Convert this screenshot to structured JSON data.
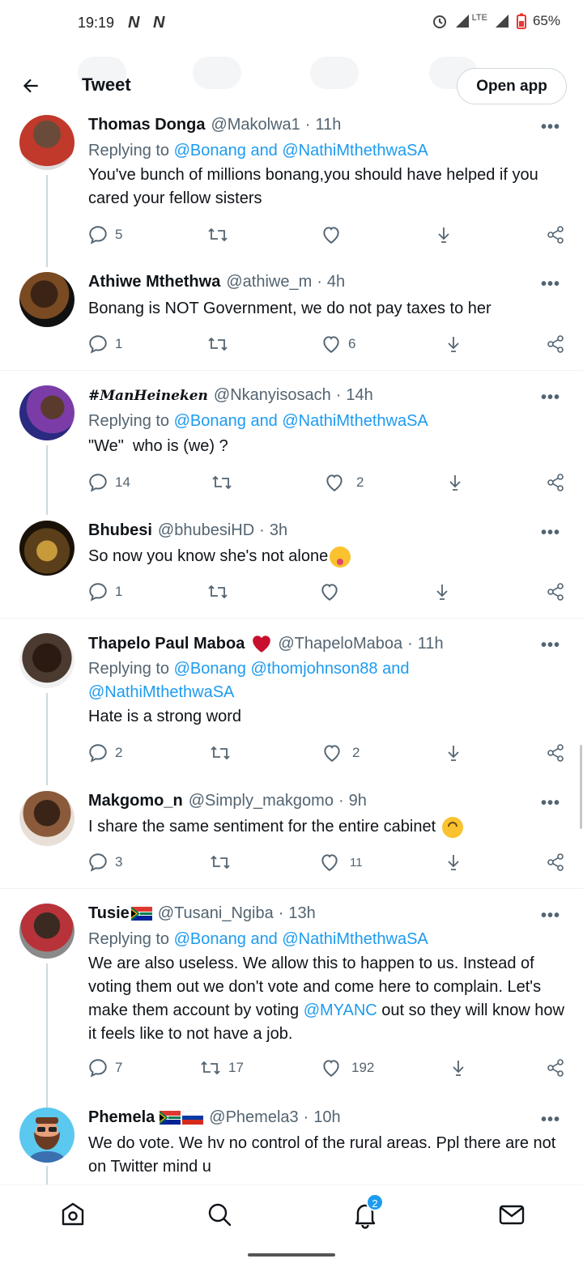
{
  "status_bar": {
    "time": "19:19",
    "notif_icons": "N N",
    "network": "LTE",
    "battery": "65%"
  },
  "header": {
    "title": "Tweet",
    "open_app": "Open app"
  },
  "tweets": [
    {
      "name": "Thomas Donga",
      "handle": "@Makolwa1",
      "time": "11h",
      "reply_prefix": "Replying to",
      "reply_mentions": "@Bonang and @NathiMthethwaSA",
      "text": "You've bunch of millions bonang,you should have helped if you cared your fellow sisters",
      "replies": "5",
      "retweets": "",
      "likes": ""
    },
    {
      "name": "Athiwe Mthethwa",
      "handle": "@athiwe_m",
      "time": "4h",
      "text": "Bonang is NOT Government, we do not pay taxes to her",
      "replies": "1",
      "retweets": "",
      "likes": "6"
    },
    {
      "name": "#ManHeineken",
      "handle": "@Nkanyisosach",
      "time": "14h",
      "reply_prefix": "Replying to",
      "reply_mentions": "@Bonang and @NathiMthethwaSA",
      "text": "\"We\"  who is (we) ?",
      "replies": "14",
      "retweets": "",
      "likes": "2"
    },
    {
      "name": "Bhubesi",
      "handle": "@bhubesiHD",
      "time": "3h",
      "text": "So now you know she's not alone",
      "replies": "1",
      "retweets": "",
      "likes": ""
    },
    {
      "name": "Thapelo Paul Maboa",
      "handle": "@ThapeloMaboa",
      "time": "11h",
      "reply_prefix": "Replying to",
      "reply_mentions_1": "@Bonang @thomjohnson88 and",
      "reply_mentions_2": "@NathiMthethwaSA",
      "text": "Hate is a strong word",
      "replies": "2",
      "retweets": "",
      "likes": "2"
    },
    {
      "name": "Makgomo_n",
      "handle": "@Simply_makgomo",
      "time": "9h",
      "text": "I share the same sentiment for the entire cabinet",
      "replies": "3",
      "retweets": "",
      "likes": "11"
    },
    {
      "name": "Tusie",
      "handle": "@Tusani_Ngiba",
      "time": "13h",
      "reply_prefix": "Replying to",
      "reply_mentions": "@Bonang and @NathiMthethwaSA",
      "text_before": "We are also useless. We allow this to happen to us. Instead of voting them out we don't vote and come here to complain. Let's make them account by voting ",
      "text_mention": "@MYANC",
      "text_after": " out so they will know how it feels like to not have a job.",
      "replies": "7",
      "retweets": "17",
      "likes": "192"
    },
    {
      "name": "Phemela",
      "handle": "@Phemela3",
      "time": "10h",
      "text": "We do vote. We hv no control of the rural areas. Ppl there are not on Twitter mind u"
    }
  ],
  "more_label": "•••",
  "notifications_badge": "2",
  "colors": {
    "accent": "#1d9bf0",
    "secondary_text": "#536471",
    "heart": "#c8102e",
    "divider": "#eff3f4"
  }
}
